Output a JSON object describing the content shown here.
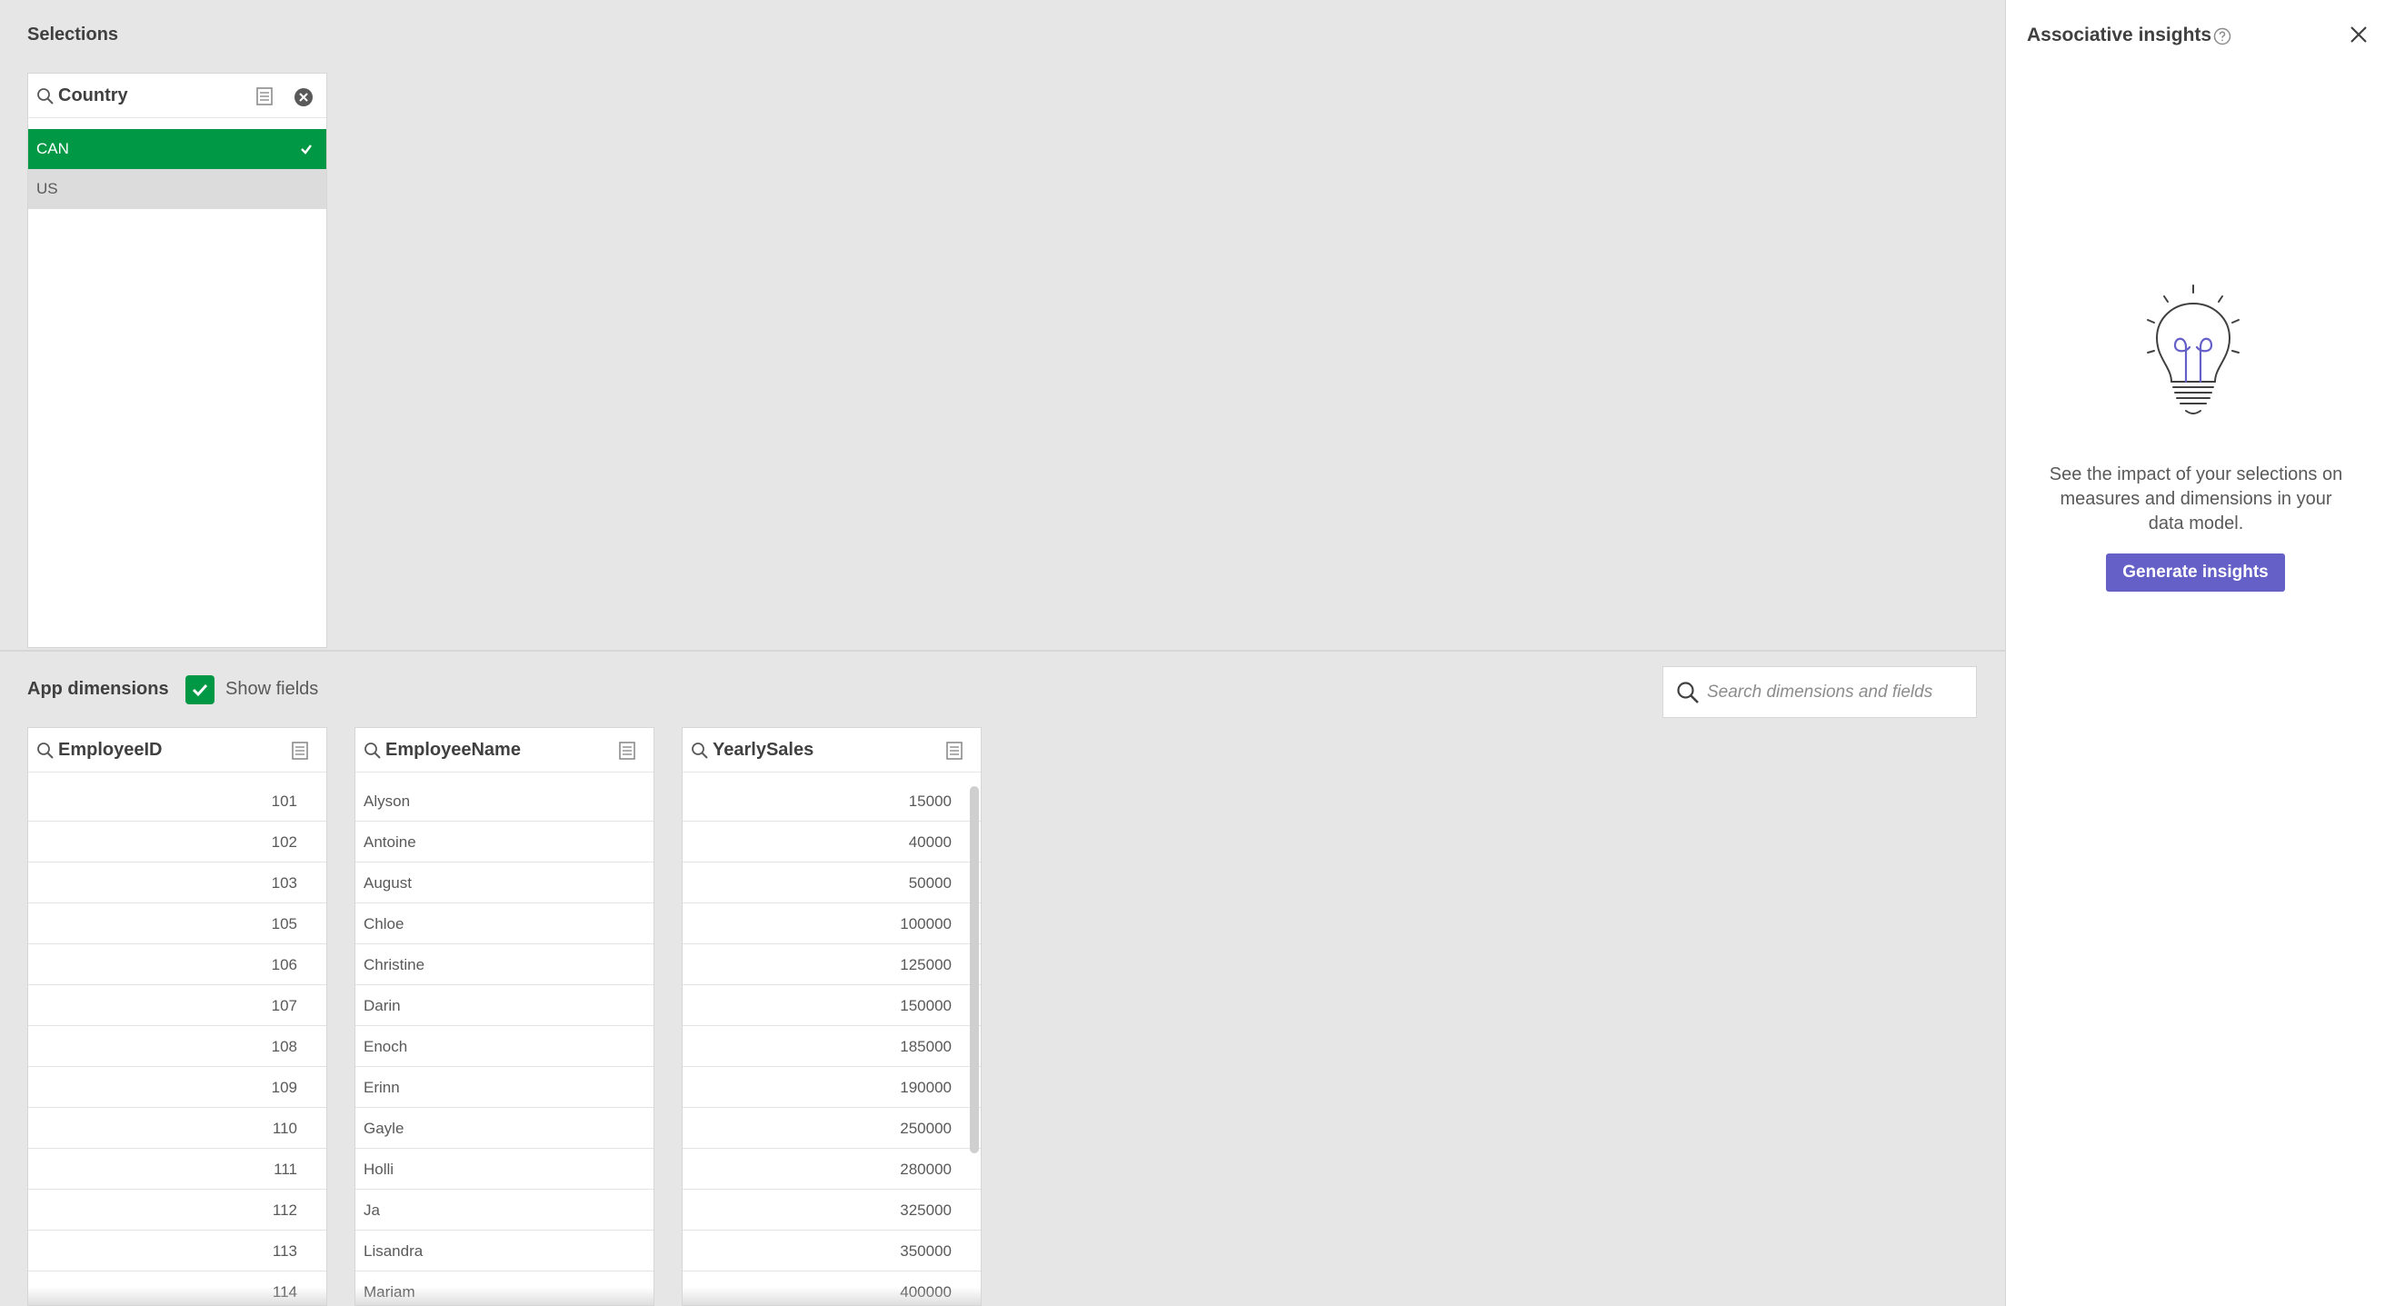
{
  "selections": {
    "title": "Selections",
    "country_listbox": {
      "title": "Country",
      "items": [
        {
          "label": "CAN",
          "state": "selected"
        },
        {
          "label": "US",
          "state": "alternative"
        }
      ]
    }
  },
  "app_dimensions": {
    "title": "App dimensions",
    "show_fields_label": "Show fields",
    "show_fields_checked": true,
    "search_placeholder": "Search dimensions and fields",
    "fields": [
      {
        "title": "EmployeeID",
        "values": [
          "101",
          "102",
          "103",
          "105",
          "106",
          "107",
          "108",
          "109",
          "110",
          "111",
          "112",
          "113",
          "114"
        ]
      },
      {
        "title": "EmployeeName",
        "values": [
          "Alyson",
          "Antoine",
          "August",
          "Chloe",
          "Christine",
          "Darin",
          "Enoch",
          "Erinn",
          "Gayle",
          "Holli",
          "Ja",
          "Lisandra",
          "Mariam"
        ]
      },
      {
        "title": "YearlySales",
        "values": [
          "15000",
          "40000",
          "50000",
          "100000",
          "125000",
          "150000",
          "185000",
          "190000",
          "250000",
          "280000",
          "325000",
          "350000",
          "400000"
        ]
      }
    ]
  },
  "insights_panel": {
    "title": "Associative insights",
    "description": "See the impact of your selections on measures and dimensions in your data model.",
    "button_label": "Generate insights"
  },
  "colors": {
    "selected_green": "#009845",
    "alternative_gray": "#dcdcdc",
    "button_purple": "#6560c7"
  }
}
